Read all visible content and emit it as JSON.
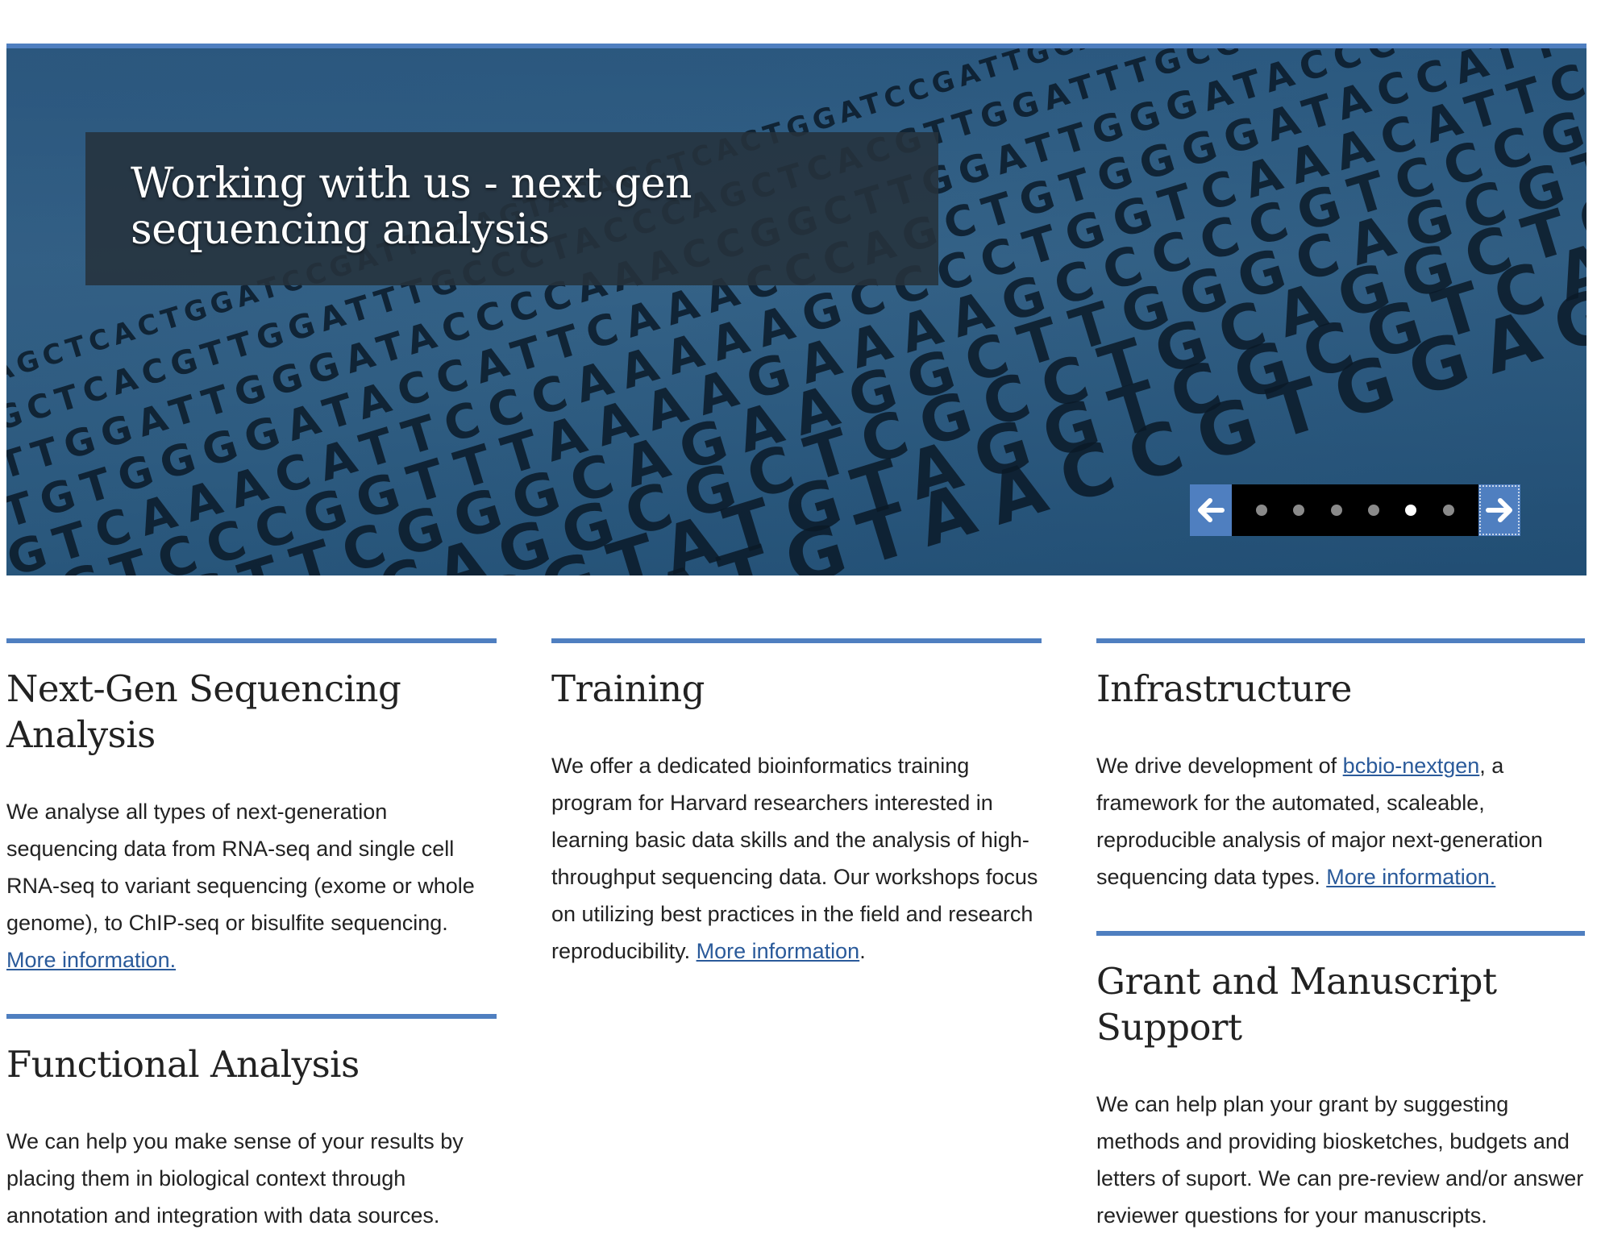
{
  "hero": {
    "caption": "Working with us - next gen sequencing analysis",
    "background_letters": [
      "AGCTCACTGGATCCGATTGCAGTAC",
      "GCTCACGTTGGATTTGCCCTACCCA",
      "TTGGATTGGGATACCCCAAACCGGC",
      "TGTGGGGATACCATTCAAACCCAGC",
      "GTCAAACATTCCCAAAAAGCCCCTG",
      "CGTCCCGGTTTAAAAGAAAAGCCCC",
      "AGCGTTCGGGCAGAAGGCTTGGGC",
      "CTGACGCAGGCGCTCGCCTGCAGG",
      "AGTCTGGCGTATGTAGGTCGCGTC",
      "CTGACCTGGATGTAACCGTGGAGC"
    ],
    "carousel": {
      "prev_icon": "arrow-left-icon",
      "next_icon": "arrow-right-icon",
      "slide_count": 6,
      "active_slide": 5
    }
  },
  "sections": {
    "ngs": {
      "title": "Next-Gen Sequencing Analysis",
      "text": "We analyse all types of next-generation sequencing data from RNA-seq and single cell RNA-seq to variant sequencing (exome or whole genome), to ChIP-seq or bisulfite sequencing.",
      "link": "More information."
    },
    "functional": {
      "title": "Functional Analysis",
      "text": "We can help you make sense of your results by placing them in biological context through annotation and integration with data sources."
    },
    "training": {
      "title": "Training",
      "text": "We offer a dedicated bioinformatics training program for Harvard researchers interested in learning basic data skills and the analysis of high-throughput sequencing data. Our workshops focus on utilizing best practices in the field and research reproducibility.",
      "link": "More information",
      "link_suffix": "."
    },
    "infrastructure": {
      "title": "Infrastructure",
      "text_before": "We drive development of ",
      "link_bcbio": "bcbio-nextgen",
      "text_after": ", a framework for the automated, scaleable, reproducible analysis of major next-generation sequencing data types.",
      "link": "More information."
    },
    "grant": {
      "title": "Grant and Manuscript Support",
      "text": "We can help plan your grant by suggesting methods and providing biosketches, budgets and letters of suport. We can pre-review and/or answer reviewer questions for your manuscripts."
    }
  },
  "colors": {
    "accent": "#4f7fc0",
    "link": "#2a5a9a",
    "caption_bg": "#26323c",
    "text": "#222222"
  }
}
